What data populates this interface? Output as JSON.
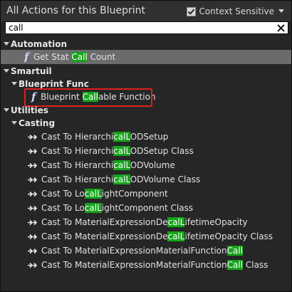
{
  "header": {
    "title": "All Actions for this Blueprint",
    "context_sensitive_label": "Context Sensitive",
    "context_sensitive_checked": true
  },
  "search": {
    "value": "call"
  },
  "tree": {
    "automation": {
      "label": "Automation",
      "items": [
        {
          "pre": "Get Stat ",
          "match": "Call",
          "post": " Count"
        }
      ]
    },
    "smartuil": {
      "label": "Smartuil",
      "blueprint_func": {
        "label": "Blueprint Func",
        "items": [
          {
            "pre": "Blueprint ",
            "match": "Call",
            "post": "able Function"
          }
        ]
      }
    },
    "utilities": {
      "label": "Utilities",
      "casting": {
        "label": "Casting",
        "items": [
          {
            "pre": "Cast To Hierarchi",
            "match": "calL",
            "post": "ODSetup"
          },
          {
            "pre": "Cast To Hierarchi",
            "match": "calL",
            "post": "ODSetup Class"
          },
          {
            "pre": "Cast To Hierarchi",
            "match": "calL",
            "post": "ODVolume"
          },
          {
            "pre": "Cast To Hierarchi",
            "match": "calL",
            "post": "ODVolume Class"
          },
          {
            "pre": "Cast To Lo",
            "match": "calL",
            "post": "ightComponent"
          },
          {
            "pre": "Cast To Lo",
            "match": "calL",
            "post": "ightComponent Class"
          },
          {
            "pre": "Cast To MaterialExpressionDe",
            "match": "calL",
            "post": "ifetimeOpacity"
          },
          {
            "pre": "Cast To MaterialExpressionDe",
            "match": "calL",
            "post": "ifetimeOpacity Class"
          },
          {
            "pre": "Cast To MaterialExpressionMaterialFunction",
            "match": "Call",
            "post": ""
          },
          {
            "pre": "Cast To MaterialExpressionMaterialFunction",
            "match": "Call",
            "post": " Class"
          }
        ]
      }
    }
  },
  "icons": {
    "function": "function-f-icon",
    "cast": "cast-arrow-icon",
    "expand": "expand-arrow-icon",
    "clear": "clear-x-icon",
    "dropdown": "chevron-down-icon"
  },
  "colors": {
    "match_highlight": "#16a31b",
    "selected_row": "#6b6b6b",
    "annotation_box": "#e0201e"
  }
}
